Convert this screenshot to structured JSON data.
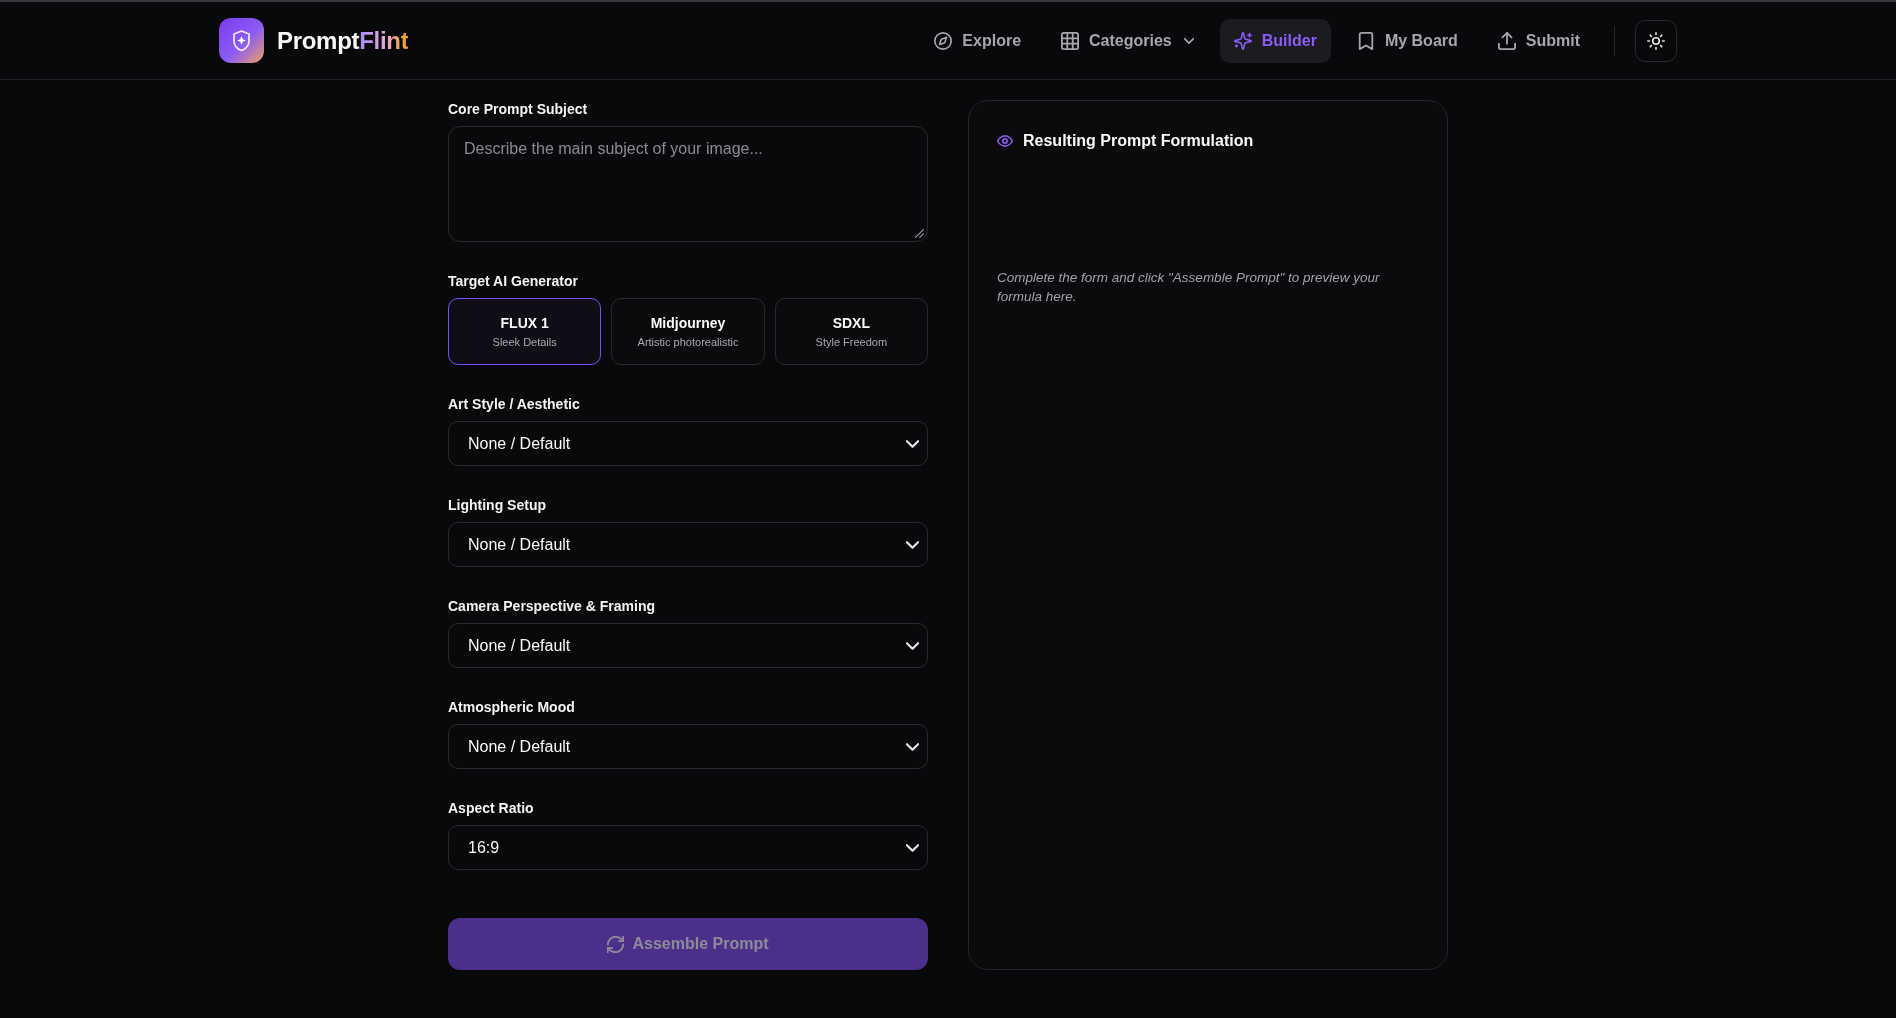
{
  "header": {
    "brand": {
      "name": "Prompt",
      "accent": "Flint"
    },
    "nav": [
      {
        "label": "Explore",
        "dropdown": false,
        "selected": false
      },
      {
        "label": "Categories",
        "dropdown": true,
        "selected": false
      },
      {
        "label": "Builder",
        "dropdown": false,
        "selected": true
      },
      {
        "label": "My Board",
        "dropdown": false,
        "selected": false
      },
      {
        "label": "Submit",
        "dropdown": false,
        "selected": false
      }
    ]
  },
  "form": {
    "subject": {
      "label": "Core Prompt Subject",
      "placeholder": "Describe the main subject of your image..."
    },
    "generator": {
      "label": "Target AI Generator",
      "options": [
        {
          "name": "FLUX 1",
          "description": "Sleek Details",
          "selected": true
        },
        {
          "name": "Midjourney",
          "description": "Artistic photorealistic",
          "selected": false
        },
        {
          "name": "SDXL",
          "description": "Style Freedom",
          "selected": false
        }
      ]
    },
    "selects": [
      {
        "label": "Art Style / Aesthetic",
        "value": "None / Default"
      },
      {
        "label": "Lighting Setup",
        "value": "None / Default"
      },
      {
        "label": "Camera Perspective & Framing",
        "value": "None / Default"
      },
      {
        "label": "Atmospheric Mood",
        "value": "None / Default"
      },
      {
        "label": "Aspect Ratio",
        "value": "16:9"
      }
    ],
    "submit": {
      "label": "Assemble Prompt",
      "disabled": true
    }
  },
  "preview": {
    "title": "Resulting Prompt Formulation",
    "hint": "Complete the form and click \"Assemble Prompt\" to preview your formula here."
  }
}
